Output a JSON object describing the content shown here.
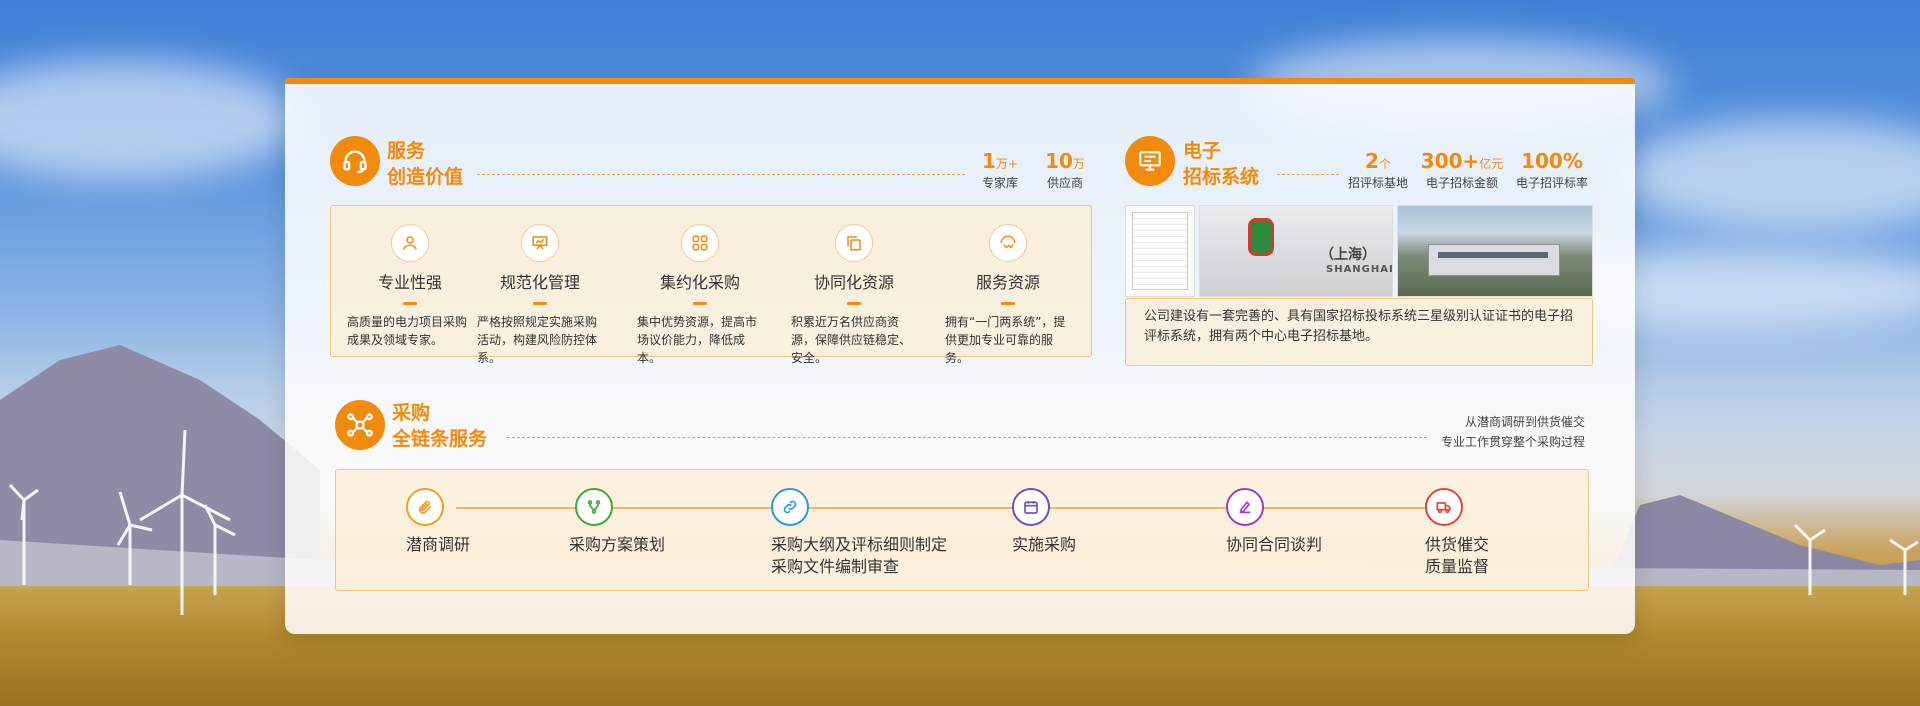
{
  "colors": {
    "accent": "#f28a0e"
  },
  "service": {
    "title_line1": "服务",
    "title_line2": "创造价值",
    "icon": "headset-icon",
    "stats": [
      {
        "value": "1",
        "unit": "万+",
        "label": "专家库"
      },
      {
        "value": "10",
        "unit": "万",
        "label": "供应商"
      }
    ],
    "items": [
      {
        "name": "专业性强",
        "icon": "user-icon",
        "desc": "高质量的电力项目采购成果及领域专家。"
      },
      {
        "name": "规范化管理",
        "icon": "presentation-board-icon",
        "desc": "严格按照规定实施采购活动，构建风险防控体系。"
      },
      {
        "name": "集约化采购",
        "icon": "grid-icon",
        "desc": "集中优势资源，提高市场议价能力，降低成本。"
      },
      {
        "name": "协同化资源",
        "icon": "copy-icon",
        "desc": "积累近万名供应商资源，保障供应链稳定、安全。"
      },
      {
        "name": "服务资源",
        "icon": "handshake-icon",
        "desc": "拥有“一门两系统”，提供更加专业可靠的服务。"
      }
    ]
  },
  "eproc": {
    "title_line1": "电子",
    "title_line2": "招标系统",
    "icon": "monitor-icon",
    "stats": [
      {
        "value": "2",
        "unit": "个",
        "label": "招评标基地"
      },
      {
        "value": "300+",
        "unit": "亿元",
        "label": "电子招标金额"
      },
      {
        "value": "100%",
        "unit": "",
        "label": "电子招评标率"
      }
    ],
    "sign_text": "（上海）",
    "sign_sub": "SHANGHAI",
    "description": "公司建设有一套完善的、具有国家招标投标系统三星级别认证证书的电子招评标系统，拥有两个中心电子招标基地。"
  },
  "procurement": {
    "title_line1": "采购",
    "title_line2": "全链条服务",
    "icon": "network-icon",
    "note_line1": "从潜商调研到供货催交",
    "note_line2": "专业工作贯穿整个采购过程",
    "steps": [
      {
        "label1": "潜商调研",
        "label2": "",
        "icon": "paperclip-icon",
        "color": "#f0a020"
      },
      {
        "label1": "采购方案策划",
        "label2": "",
        "icon": "branch-icon",
        "color": "#3aaa35"
      },
      {
        "label1": "采购大纲及评标细则制定",
        "label2": "采购文件编制审查",
        "icon": "link-icon",
        "color": "#2a9bd8"
      },
      {
        "label1": "实施采购",
        "label2": "",
        "icon": "calendar-icon",
        "color": "#6a4fc4"
      },
      {
        "label1": "协同合同谈判",
        "label2": "",
        "icon": "signature-icon",
        "color": "#a23bbf"
      },
      {
        "label1": "供货催交",
        "label2": "质量监督",
        "icon": "truck-icon",
        "color": "#e0453a"
      }
    ]
  }
}
